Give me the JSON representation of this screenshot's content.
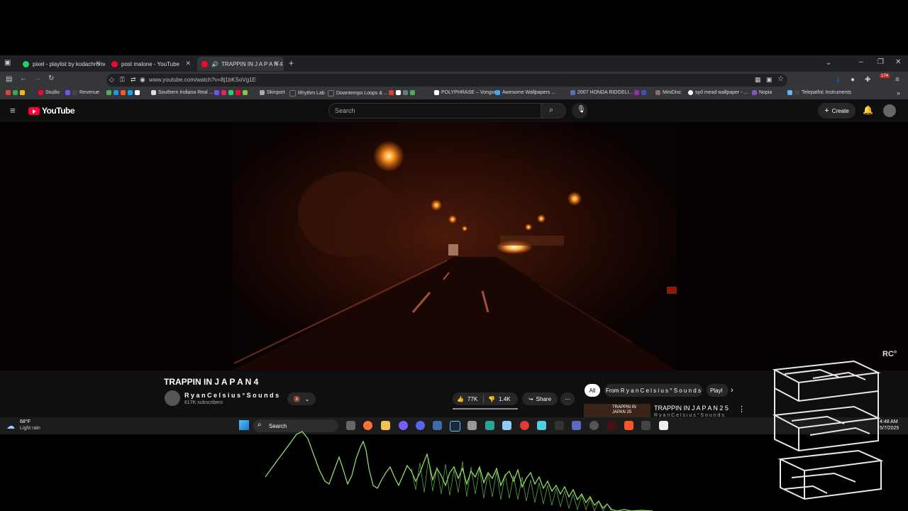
{
  "tabs": [
    {
      "label": "pixel - playlist by kodachrome!!",
      "active": false,
      "color": "#1ed760"
    },
    {
      "label": "post malone - YouTube",
      "active": false,
      "color": "#ff0033"
    },
    {
      "label": "TRAPPIN IN  J A P A N  4",
      "active": true,
      "color": "#ff0033"
    }
  ],
  "address": {
    "url": "www.youtube.com/watch?v=8j1bKSoVg1E",
    "badge": "174"
  },
  "bookmarks": [
    "Studio",
    "Revenue",
    "Southern Indiana Real ...",
    "Skinport",
    "Rhythm Lab",
    "Downtempo Loops & ...",
    "POLYPHRASE – Vongon",
    "Awesome Wallpapers ...",
    "2007 HONDA RIDGELI...",
    "MiniDisc",
    "syd mead wallpaper - ...",
    "Nopia",
    "Telepathic Instruments"
  ],
  "youtube": {
    "brand": "YouTube",
    "search_placeholder": "Search",
    "create_label": "Create"
  },
  "video": {
    "title": "TRAPPIN IN  J A P A N  4",
    "channel": "R y a n C e l s i u s ° S o u n d s",
    "subscribers": "617K subscribers",
    "likes": "77K",
    "dislikes": "1.4K",
    "share_label": "Share"
  },
  "side": {
    "chips": [
      "All",
      "From R y a n C e l s i u s ° S o u n d s",
      "Playl"
    ],
    "rec_title": "TRAPPIN IN  J A P A N  2 5",
    "rec_channel": "R y a n C e l s i u s ° S o u n d s",
    "rec_thumb_text": "TRAPPIN IN JAPAN 25"
  },
  "taskbar": {
    "weather_temp": "68°F",
    "weather_desc": "Light rain",
    "search_label": "Search",
    "time": "4:48 AM",
    "date": "5/7/2025"
  },
  "overlay": {
    "logo": "RC°"
  }
}
